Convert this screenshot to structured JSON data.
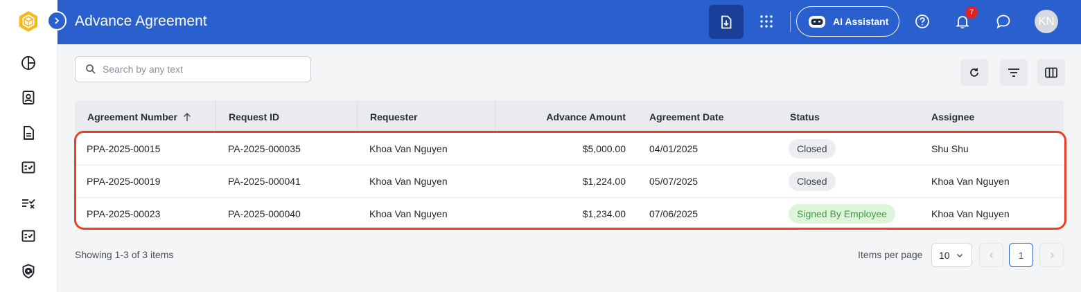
{
  "header": {
    "title": "Advance Agreement",
    "ai_assistant_label": "AI Assistant",
    "notification_count": "7",
    "avatar_initials": "KN"
  },
  "sidebar": {
    "items": [
      {
        "icon": "pie-chart-icon"
      },
      {
        "icon": "contact-book-icon"
      },
      {
        "icon": "document-icon"
      },
      {
        "icon": "checklist-icon"
      },
      {
        "icon": "task-list-icon"
      },
      {
        "icon": "approval-list-icon"
      },
      {
        "icon": "at-shield-icon"
      }
    ]
  },
  "search": {
    "placeholder": "Search by any text",
    "value": ""
  },
  "toolbar": {
    "buttons": [
      "refresh-icon",
      "filter-icon",
      "columns-icon"
    ]
  },
  "table": {
    "columns": [
      "Agreement Number",
      "Request ID",
      "Requester",
      "Advance Amount",
      "Agreement Date",
      "Status",
      "Assignee"
    ],
    "sort": {
      "column": "Agreement Number",
      "direction": "ascending"
    },
    "rows": [
      {
        "agreement_number": "PPA-2025-00015",
        "request_id": "PA-2025-000035",
        "requester": "Khoa Van Nguyen",
        "amount": "$5,000.00",
        "date": "04/01/2025",
        "status": "Closed",
        "assignee": "Shu Shu"
      },
      {
        "agreement_number": "PPA-2025-00019",
        "request_id": "PA-2025-000041",
        "requester": "Khoa Van Nguyen",
        "amount": "$1,224.00",
        "date": "05/07/2025",
        "status": "Closed",
        "assignee": "Khoa Van Nguyen"
      },
      {
        "agreement_number": "PPA-2025-00023",
        "request_id": "PA-2025-000040",
        "requester": "Khoa Van Nguyen",
        "amount": "$1,234.00",
        "date": "07/06/2025",
        "status": "Signed By Employee",
        "assignee": "Khoa Van Nguyen"
      }
    ]
  },
  "footer": {
    "showing_text": "Showing 1-3 of 3 items",
    "items_per_page_label": "Items per page",
    "items_per_page_value": "10",
    "current_page": "1"
  },
  "colors": {
    "brand": "#2a5fce",
    "highlight": "#e64027",
    "status_closed_bg": "#ebedf0",
    "status_signed_bg": "#def5dc",
    "status_signed_text": "#3d9a3c",
    "notification_badge": "#e02424"
  }
}
